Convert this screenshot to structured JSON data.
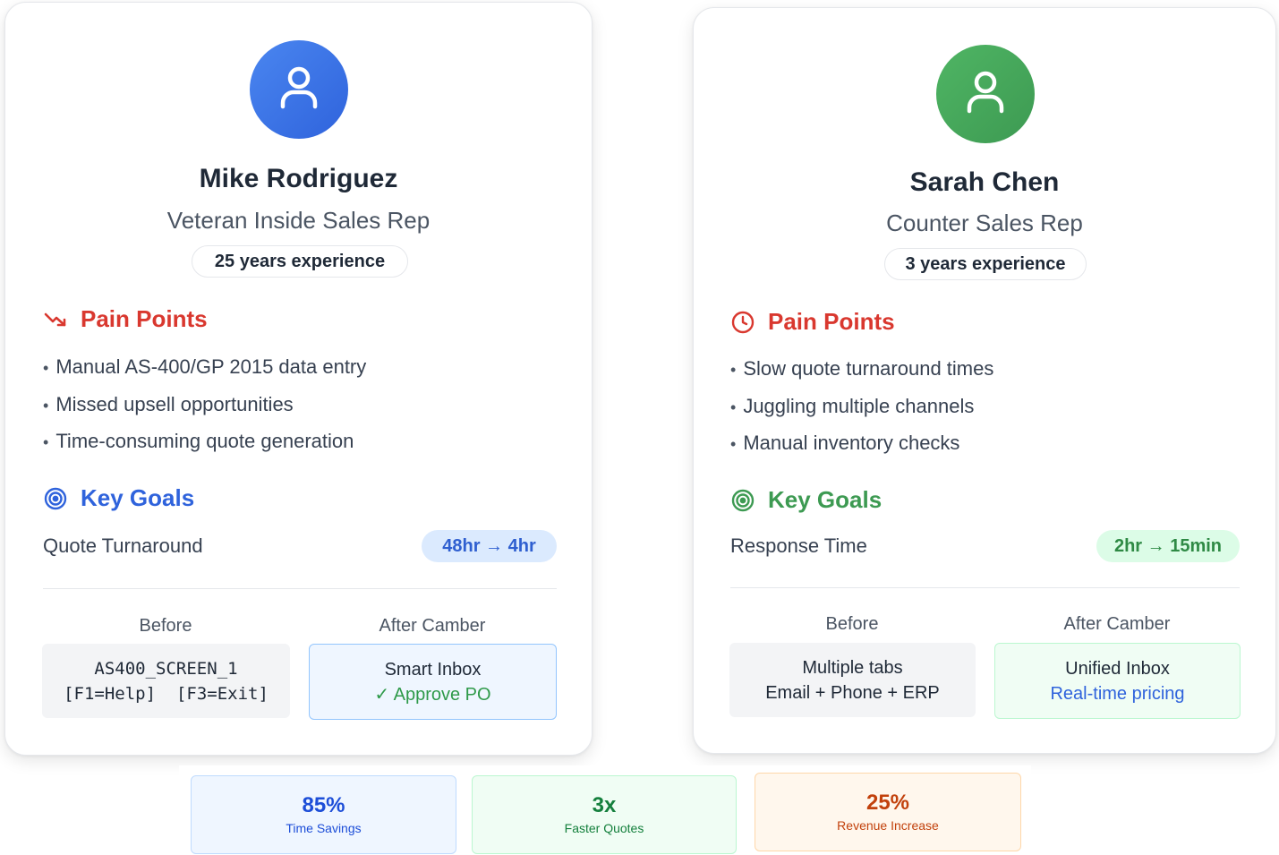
{
  "personas": [
    {
      "avatar_icon": "user-icon",
      "accent": "#2f63dc",
      "name": "Mike Rodriguez",
      "role": "Veteran Inside Sales Rep",
      "experience": "25 years experience",
      "pain_points": {
        "icon": "trending-down-icon",
        "title": "Pain Points",
        "items": [
          "Manual AS-400/GP 2015 data entry",
          "Missed upsell opportunities",
          "Time-consuming quote generation"
        ]
      },
      "key_goals": {
        "icon": "target-icon",
        "title": "Key Goals",
        "metric_label": "Quote Turnaround",
        "metric_value": "48hr → 4hr"
      },
      "before": {
        "label": "Before",
        "line1": "AS400_SCREEN_1",
        "line2": "[F1=Help]  [F3=Exit]"
      },
      "after": {
        "label": "After Camber",
        "line1": "Smart Inbox",
        "line2": "✓ Approve PO"
      }
    },
    {
      "avatar_icon": "user-icon",
      "accent": "#3d9a52",
      "name": "Sarah Chen",
      "role": "Counter Sales Rep",
      "experience": "3 years experience",
      "pain_points": {
        "icon": "clock-icon",
        "title": "Pain Points",
        "items": [
          "Slow quote turnaround times",
          "Juggling multiple channels",
          "Manual inventory checks"
        ]
      },
      "key_goals": {
        "icon": "target-icon",
        "title": "Key Goals",
        "metric_label": "Response Time",
        "metric_value": "2hr → 15min"
      },
      "before": {
        "label": "Before",
        "line1": "Multiple tabs",
        "line2": "Email + Phone + ERP"
      },
      "after": {
        "label": "After Camber",
        "line1": "Unified Inbox",
        "line2": "Real-time pricing"
      }
    }
  ],
  "stats": [
    {
      "value": "85%",
      "label": "Time Savings",
      "color": "#1d4ed8"
    },
    {
      "value": "3x",
      "label": "Faster Quotes",
      "color": "#15803d"
    },
    {
      "value": "25%",
      "label": "Revenue Increase",
      "color": "#c2410c"
    }
  ]
}
